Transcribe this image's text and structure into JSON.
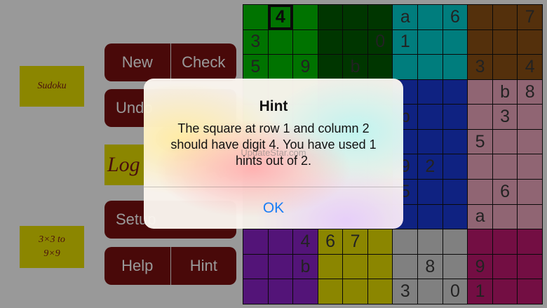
{
  "app": {
    "title_badge": "Sudoku",
    "logo_badge": "Log",
    "size_badge_line1": "3×3 to",
    "size_badge_line2": "9×9"
  },
  "buttons": {
    "new": "New",
    "check": "Check",
    "undo": "Undo",
    "setup": "Setup",
    "help": "Help",
    "hint": "Hint"
  },
  "board": {
    "colors": {
      "green": "#00c000",
      "darkgreen": "#005a00",
      "cyan": "#00d0d0",
      "brown": "#8c5014",
      "blue": "#1a3ad8",
      "pink": "#f0a8c0",
      "purple": "#8a22c8",
      "yellow": "#e8e000",
      "gray": "#d6d6d6",
      "magenta": "#c01870"
    },
    "cells": [
      [
        "",
        "4",
        "",
        "",
        "",
        "",
        "a",
        "",
        "6",
        "",
        "",
        "7"
      ],
      [
        "3",
        "",
        "",
        "",
        "",
        "0",
        "1",
        "",
        "",
        "",
        "",
        ""
      ],
      [
        "5",
        "",
        "9",
        "",
        "b",
        "",
        "",
        "",
        "",
        "3",
        "",
        "4"
      ],
      [
        "",
        "",
        "",
        "",
        "",
        "",
        "",
        "",
        "",
        "",
        "b",
        "8"
      ],
      [
        "",
        "",
        "",
        "",
        "",
        "",
        "b",
        "",
        "",
        "",
        "3",
        ""
      ],
      [
        "",
        "",
        "",
        "",
        "",
        "",
        "",
        "",
        "",
        "5",
        "",
        ""
      ],
      [
        "",
        "",
        "",
        "",
        "",
        "",
        "9",
        "2",
        "",
        "",
        "",
        ""
      ],
      [
        "",
        "",
        "",
        "",
        "",
        "",
        "5",
        "",
        "",
        "",
        "6",
        ""
      ],
      [
        "",
        "",
        "",
        "",
        "",
        "",
        "",
        "",
        "",
        "a",
        "",
        ""
      ],
      [
        "",
        "",
        "4",
        "6",
        "7",
        "",
        "",
        "",
        "",
        "",
        "",
        ""
      ],
      [
        "",
        "",
        "b",
        "",
        "",
        "",
        "",
        "8",
        "",
        "9",
        "",
        ""
      ],
      [
        "",
        "",
        "",
        "",
        "",
        "",
        "3",
        "",
        "0",
        "1",
        "",
        ""
      ]
    ],
    "selected": {
      "row": 1,
      "column": 2
    }
  },
  "dialog": {
    "title": "Hint",
    "message": "The square at row 1 and column 2 should have digit 4. You have used 1 hints out of 2.",
    "watermark": "UpdateStar.com",
    "ok_label": "OK"
  }
}
